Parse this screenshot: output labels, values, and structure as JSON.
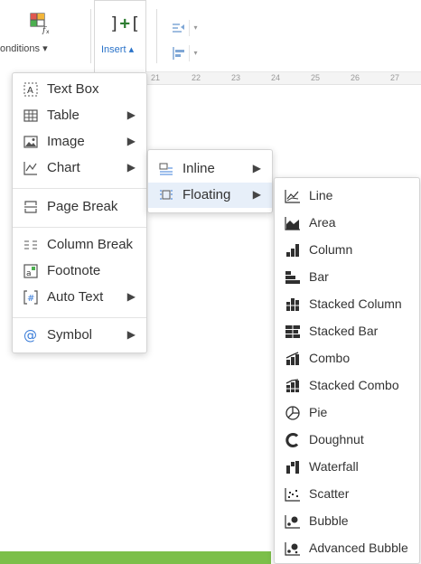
{
  "toolbar": {
    "conditions_label": "onditions ▾",
    "insert_label": "Insert ▴",
    "insert_glyph_left": "]",
    "insert_glyph_plus": "+",
    "insert_glyph_right": "[",
    "dropdown_glyph": "▾"
  },
  "ruler": {
    "ticks": [
      "21",
      "22",
      "23",
      "24",
      "25",
      "26",
      "27"
    ]
  },
  "insert_menu": {
    "text_box": "Text Box",
    "table": "Table",
    "image": "Image",
    "chart": "Chart",
    "page_break": "Page Break",
    "column_break": "Column Break",
    "footnote": "Footnote",
    "auto_text": "Auto Text",
    "symbol": "Symbol",
    "arrow": "▶"
  },
  "chart_menu": {
    "inline": "Inline",
    "floating": "Floating",
    "arrow": "▶"
  },
  "chart_types": [
    {
      "label": "Line",
      "icon": "line-chart-icon"
    },
    {
      "label": "Area",
      "icon": "area-chart-icon"
    },
    {
      "label": "Column",
      "icon": "column-chart-icon"
    },
    {
      "label": "Bar",
      "icon": "bar-chart-icon"
    },
    {
      "label": "Stacked Column",
      "icon": "stacked-column-chart-icon"
    },
    {
      "label": "Stacked Bar",
      "icon": "stacked-bar-chart-icon"
    },
    {
      "label": "Combo",
      "icon": "combo-chart-icon"
    },
    {
      "label": "Stacked Combo",
      "icon": "stacked-combo-chart-icon"
    },
    {
      "label": "Pie",
      "icon": "pie-chart-icon"
    },
    {
      "label": "Doughnut",
      "icon": "doughnut-chart-icon"
    },
    {
      "label": "Waterfall",
      "icon": "waterfall-chart-icon"
    },
    {
      "label": "Scatter",
      "icon": "scatter-chart-icon"
    },
    {
      "label": "Bubble",
      "icon": "bubble-chart-icon"
    },
    {
      "label": "Advanced Bubble",
      "icon": "advanced-bubble-chart-icon"
    }
  ],
  "colors": {
    "accent_blue": "#2a73c9",
    "active_bg": "#e7eff9",
    "doc_green": "#7cbf4a",
    "icon_blue": "#3b7dd8",
    "icon_dark": "#2f2f2f"
  }
}
